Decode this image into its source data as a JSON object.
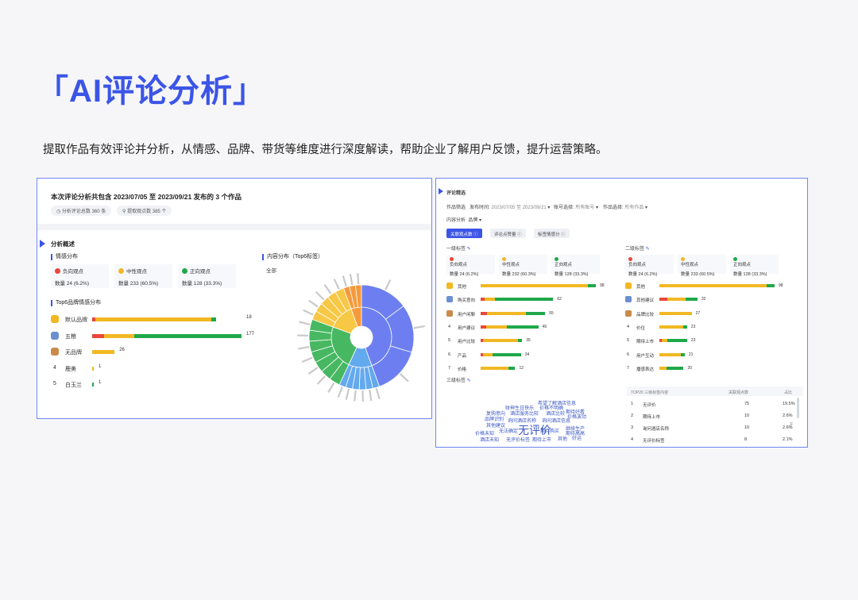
{
  "page": {
    "title": "「AI评论分析」",
    "description": "提取作品有效评论并分析，从情感、品牌、带货等维度进行深度解读，帮助企业了解用户反馈，提升运营策略。"
  },
  "colors": {
    "accent": "#3b55e6",
    "negative": "#e8473a",
    "neutral": "#f2b824",
    "positive": "#1fa84a",
    "sunburst_blue": "#6d7ff0",
    "sunburst_orange": "#f59a3c",
    "sunburst_yellow": "#f6c845",
    "sunburst_green": "#47b861",
    "sunburst_lightblue": "#63a9ee"
  },
  "left_panel": {
    "header": "本次评论分析共包含 2023/07/05 至 2023/09/21 发布的 3 个作品",
    "chip_comments": "分析评论总数 360 条",
    "chip_viewpoints": "提取观点数 385 个",
    "overview_title": "分析概述",
    "sentiment_title": "情感分布",
    "sentiment": [
      {
        "label": "负向观点",
        "value": "数量 24 (6.2%)",
        "color": "#e8473a"
      },
      {
        "label": "中性观点",
        "value": "数量 233 (60.5%)",
        "color": "#f2b824"
      },
      {
        "label": "正向观点",
        "value": "数量 128 (33.3%)",
        "color": "#1fa84a"
      }
    ],
    "brand_title": "Top6品牌情感分布",
    "brands": [
      {
        "rank": "",
        "name": "默认品牌",
        "count": "18",
        "icon": "gold-medal-icon",
        "neg": 0.02,
        "neu": 0.78,
        "pos": 0.03,
        "total": 1.0
      },
      {
        "rank": "",
        "name": "五粮",
        "count": "177",
        "icon": "silver-medal-icon",
        "neg": 0.08,
        "neu": 0.2,
        "pos": 0.72,
        "total": 1.0
      },
      {
        "rank": "",
        "name": "无品牌",
        "count": "26",
        "icon": "bronze-medal-icon",
        "neg": 0.0,
        "neu": 1.0,
        "pos": 0.0,
        "total": 0.15
      },
      {
        "rank": "4",
        "name": "鹿美",
        "count": "1",
        "icon": "",
        "neg": 0.0,
        "neu": 1.0,
        "pos": 0.0,
        "total": 0.006
      },
      {
        "rank": "5",
        "name": "白玉兰",
        "count": "1",
        "icon": "",
        "neg": 0.0,
        "neu": 0.0,
        "pos": 1.0,
        "total": 0.006
      }
    ],
    "content_title": "内容分布（Top6标签）",
    "content_filter": "全部"
  },
  "right_panel": {
    "title": "评论精选",
    "filter_row1": {
      "works_label": "作品筛选",
      "date_label": "发布时间:",
      "date_value": "2023/07/05 至 2023/09/21",
      "account_label": "账号选择:",
      "account_value": "所有账号",
      "works_select_label": "作品选择:",
      "works_select_value": "所有作品"
    },
    "filter_row2": {
      "label": "内容分析",
      "value": "品牌"
    },
    "tabs": [
      "关联观点数",
      "评论点赞量",
      "标签情感分"
    ],
    "level1": {
      "title": "一级标签",
      "sentiment": [
        {
          "label": "负向观点",
          "value": "数量 24 (6.2%)"
        },
        {
          "label": "中性观点",
          "value": "数量 232 (60.3%)"
        },
        {
          "label": "正向观点",
          "value": "数量 128 (33.3%)"
        }
      ],
      "rows": [
        {
          "rank": "",
          "name": "其他",
          "count": "98",
          "neg": 0.0,
          "neu": 0.93,
          "pos": 0.07,
          "total": 1.0
        },
        {
          "rank": "",
          "name": "购买意向",
          "count": "62",
          "neg": 0.05,
          "neu": 0.15,
          "pos": 0.8,
          "total": 0.63
        },
        {
          "rank": "",
          "name": "用户闲聊",
          "count": "55",
          "neg": 0.1,
          "neu": 0.6,
          "pos": 0.3,
          "total": 0.56
        },
        {
          "rank": "4",
          "name": "用户建议",
          "count": "49",
          "neg": 0.1,
          "neu": 0.35,
          "pos": 0.55,
          "total": 0.5
        },
        {
          "rank": "5",
          "name": "用户比较",
          "count": "35",
          "neg": 0.05,
          "neu": 0.85,
          "pos": 0.1,
          "total": 0.36
        },
        {
          "rank": "6",
          "name": "产品",
          "count": "34",
          "neg": 0.05,
          "neu": 0.25,
          "pos": 0.7,
          "total": 0.35
        },
        {
          "rank": "7",
          "name": "价格",
          "count": "12",
          "neg": 0.0,
          "neu": 0.8,
          "pos": 0.2,
          "total": 0.3
        }
      ]
    },
    "level2": {
      "title": "二级标签",
      "sentiment": [
        {
          "label": "负向观点",
          "value": "数量 24 (6.2%)"
        },
        {
          "label": "中性观点",
          "value": "数量 233 (60.5%)"
        },
        {
          "label": "正向观点",
          "value": "数量 128 (33.3%)"
        }
      ],
      "rows": [
        {
          "rank": "",
          "name": "其他",
          "count": "98",
          "neg": 0.0,
          "neu": 0.93,
          "pos": 0.07,
          "total": 1.0
        },
        {
          "rank": "",
          "name": "其他建议",
          "count": "32",
          "neg": 0.2,
          "neu": 0.5,
          "pos": 0.3,
          "total": 0.33
        },
        {
          "rank": "",
          "name": "品牌比较",
          "count": "27",
          "neg": 0.0,
          "neu": 1.0,
          "pos": 0.0,
          "total": 0.28
        },
        {
          "rank": "4",
          "name": "价位",
          "count": "23",
          "neg": 0.0,
          "neu": 0.85,
          "pos": 0.15,
          "total": 0.24
        },
        {
          "rank": "5",
          "name": "期待上市",
          "count": "23",
          "neg": 0.1,
          "neu": 0.2,
          "pos": 0.7,
          "total": 0.24
        },
        {
          "rank": "6",
          "name": "用户互动",
          "count": "21",
          "neg": 0.0,
          "neu": 0.85,
          "pos": 0.15,
          "total": 0.22
        },
        {
          "rank": "7",
          "name": "播感表达",
          "count": "20",
          "neg": 0.0,
          "neu": 0.3,
          "pos": 0.7,
          "total": 0.21
        }
      ]
    },
    "level3": {
      "title": "三级标签",
      "words": [
        "希望了解酒店信息",
        "财神生日快乐",
        "价格不明确",
        "期待好看",
        "复购意向",
        "酒店服务比较",
        "酒店比较",
        "价格波动",
        "品牌识别",
        "询问酒店名称",
        "询问酒店信息",
        "其他建议",
        "无评价",
        "期待购买",
        "继续生产",
        "价格未知",
        "无法确定",
        "期待高高",
        "酒店未知",
        "无评价标签",
        "期待上市",
        "其他",
        "好运"
      ],
      "table_headers": [
        "TOP20 三级标签内容",
        "关联观点数",
        "占比"
      ],
      "table_rows": [
        {
          "rank": "1",
          "name": "无评价",
          "count": "75",
          "pct": "19.5%"
        },
        {
          "rank": "2",
          "name": "期待上市",
          "count": "10",
          "pct": "2.6%"
        },
        {
          "rank": "3",
          "name": "询问酒店名称",
          "count": "10",
          "pct": "2.6%"
        },
        {
          "rank": "4",
          "name": "无评价标签",
          "count": "8",
          "pct": "2.1%"
        }
      ]
    }
  }
}
